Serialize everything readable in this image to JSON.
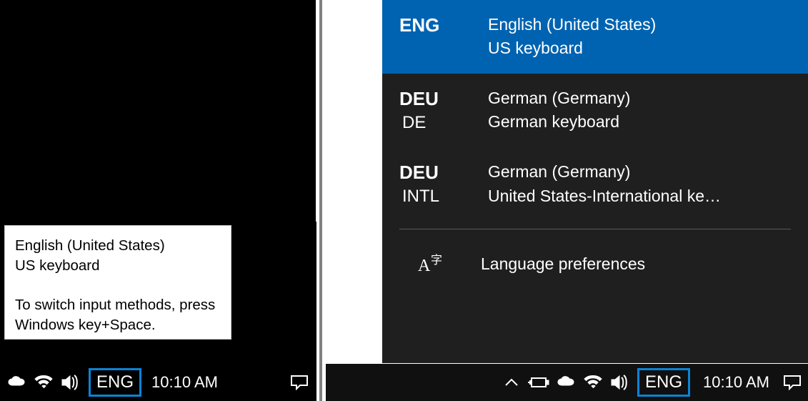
{
  "left": {
    "tooltip": {
      "line1": "English (United States)",
      "line2": "US keyboard",
      "line3": "To switch input methods, press",
      "line4": "Windows key+Space."
    },
    "taskbar": {
      "lang_indicator": "ENG",
      "clock": "10:10 AM"
    }
  },
  "right": {
    "flyout": {
      "items": [
        {
          "code1": "ENG",
          "code2": "",
          "line1": "English (United States)",
          "line2": "US keyboard",
          "selected": true
        },
        {
          "code1": "DEU",
          "code2": "DE",
          "line1": "German (Germany)",
          "line2": "German keyboard",
          "selected": false
        },
        {
          "code1": "DEU",
          "code2": "INTL",
          "line1": "German (Germany)",
          "line2": "United States-International ke…",
          "selected": false
        }
      ],
      "prefs_label": "Language preferences"
    },
    "taskbar": {
      "lang_indicator": "ENG",
      "clock": "10:10 AM"
    }
  }
}
